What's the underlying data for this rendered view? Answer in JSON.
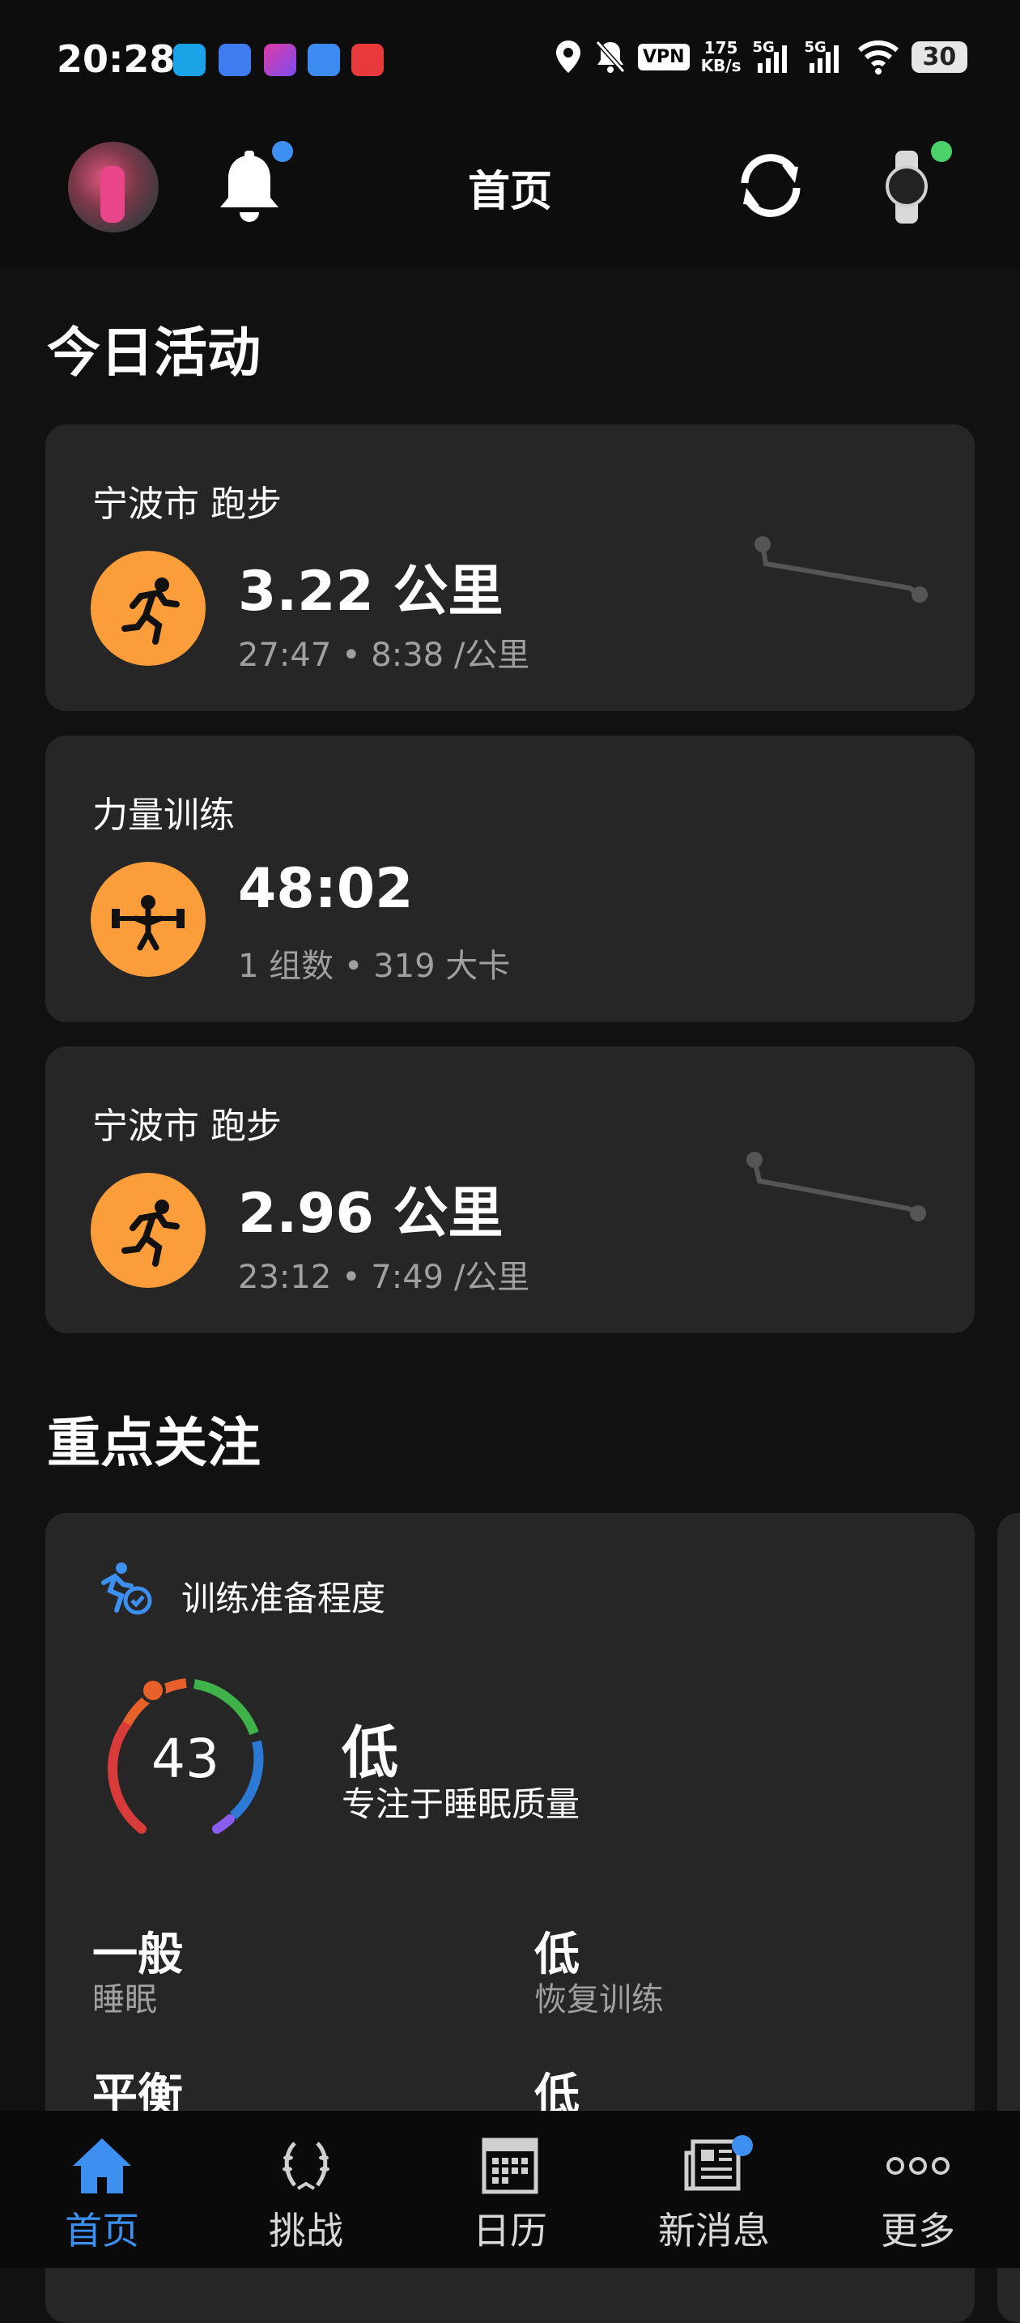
{
  "status_bar": {
    "time": "20:28",
    "vpn": "VPN",
    "speed_value": "175",
    "speed_unit": "KB/s",
    "net1": "5G",
    "net2": "5G",
    "battery": "30",
    "icons": [
      "location-icon",
      "mute-icon",
      "vpn-icon",
      "signal-icon",
      "wifi-icon",
      "battery-icon"
    ]
  },
  "header": {
    "title": "首页",
    "icons": [
      "avatar",
      "bell-icon",
      "sync-icon",
      "watch-icon"
    ]
  },
  "today": {
    "section_title": "今日活动",
    "activities": [
      {
        "title": "宁波市 跑步",
        "main": "3.22 公里",
        "sub": "27:47 • 8:38 /公里",
        "icon": "running-icon"
      },
      {
        "title": "力量训练",
        "main": "48:02",
        "sub": "1 组数 • 319  大卡",
        "icon": "weightlifting-icon"
      },
      {
        "title": "宁波市 跑步",
        "main": "2.96 公里",
        "sub": "23:12 • 7:49 /公里",
        "icon": "running-icon"
      }
    ]
  },
  "focus": {
    "section_title": "重点关注",
    "card_label": "训练准备程度",
    "score": "43",
    "level": "低",
    "description": "专注于睡眠质量",
    "metrics": [
      {
        "value": "一般",
        "label": "睡眠"
      },
      {
        "value": "低",
        "label": "恢复训练"
      },
      {
        "value": "平衡",
        "label": ""
      },
      {
        "value": "低",
        "label": ""
      }
    ]
  },
  "nav": [
    {
      "label": "首页",
      "icon": "home-icon",
      "active": true
    },
    {
      "label": "挑战",
      "icon": "laurel-icon",
      "active": false
    },
    {
      "label": "日历",
      "icon": "calendar-icon",
      "active": false
    },
    {
      "label": "新消息",
      "icon": "news-icon",
      "active": false
    },
    {
      "label": "更多",
      "icon": "more-icon",
      "active": false
    }
  ],
  "colors": {
    "accent": "#3d8ff0",
    "activity_orange": "#fa9d3a",
    "card_bg": "#262626",
    "gauge": [
      "#e8512a",
      "#d93a3a",
      "#3fb24a",
      "#2c7ad6",
      "#8a5cf0"
    ]
  }
}
